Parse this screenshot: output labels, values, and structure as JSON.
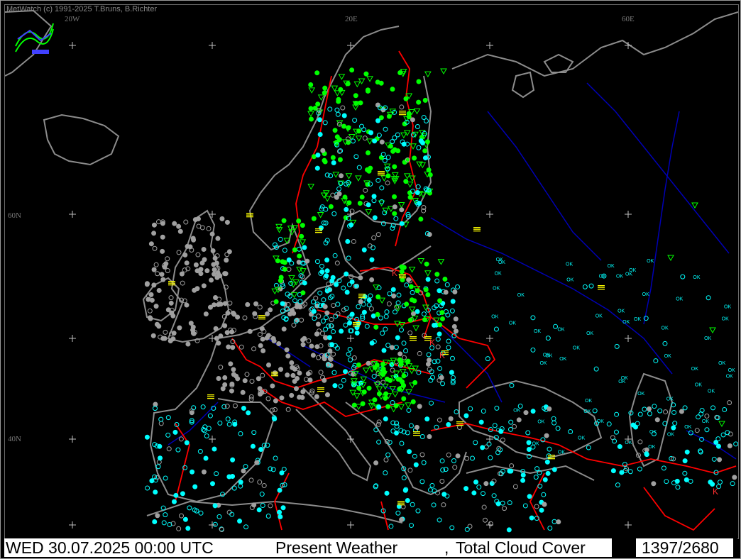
{
  "app": {
    "copyright": "MetWatch  (c) 1991-2025 T.Bruns, B.Richter"
  },
  "map": {
    "lon_labels": [
      "20W",
      "20E",
      "60E"
    ],
    "lat_labels": [
      "60N",
      "40N"
    ],
    "region": "Europe",
    "projection_grid": "plus-marks",
    "colors": {
      "background": "#000000",
      "coastline": "#8c8c8c",
      "borders": "#ff0000",
      "rivers": "#0000b4",
      "precip_symbols": "#00ff00",
      "clear_sky_symbols": "#00ffff",
      "fog_haze_symbols": "#ffff00",
      "thunder_symbols": "#ff3030",
      "cloud_symbols": "#a0a0a0"
    },
    "ok_label": "OK"
  },
  "statusbar": {
    "datetime": "WED 30.07.2025 00:00 UTC",
    "product": "Present Weather",
    "separator": ",",
    "overlay": "Total Cloud Cover",
    "counter": "1397/2680"
  }
}
